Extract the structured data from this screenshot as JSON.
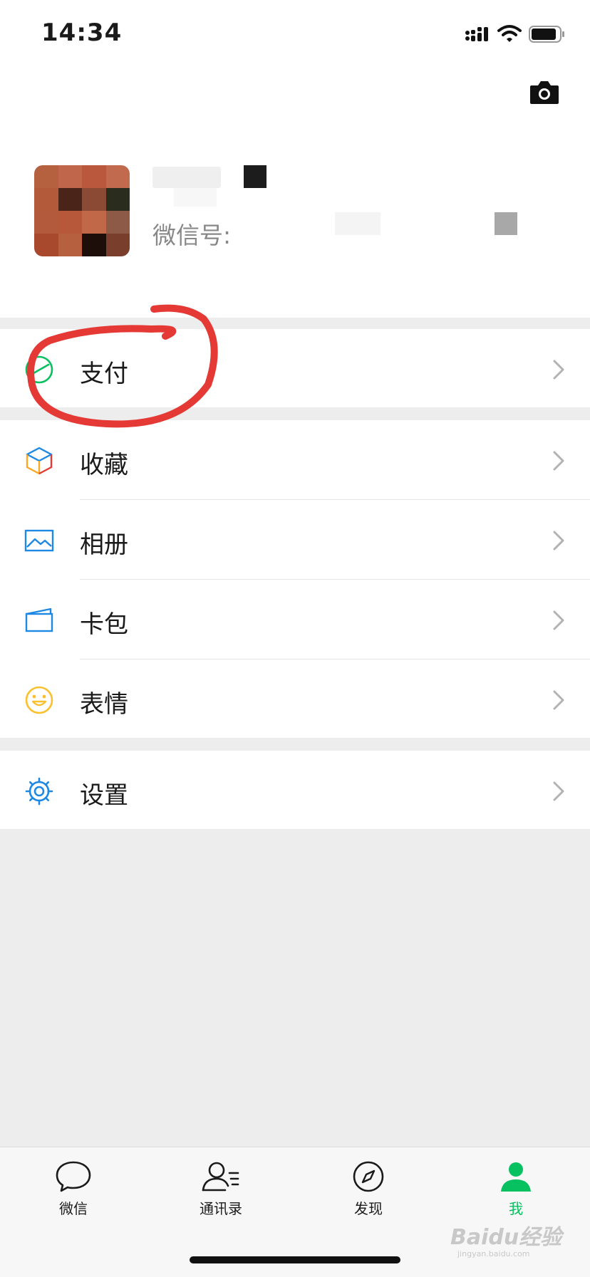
{
  "status_bar": {
    "time": "14:34"
  },
  "profile": {
    "wechat_id_label": "微信号:"
  },
  "menu": {
    "pay": "支付",
    "favorites": "收藏",
    "album": "相册",
    "cards": "卡包",
    "stickers": "表情",
    "settings": "设置"
  },
  "tabbar": {
    "chats": "微信",
    "contacts": "通讯录",
    "discover": "发现",
    "me": "我"
  },
  "watermark": {
    "brand": "Baidu经验",
    "url": "jingyan.baidu.com"
  },
  "colors": {
    "accent": "#07c160",
    "annotation": "#e53935",
    "background": "#ededed"
  }
}
